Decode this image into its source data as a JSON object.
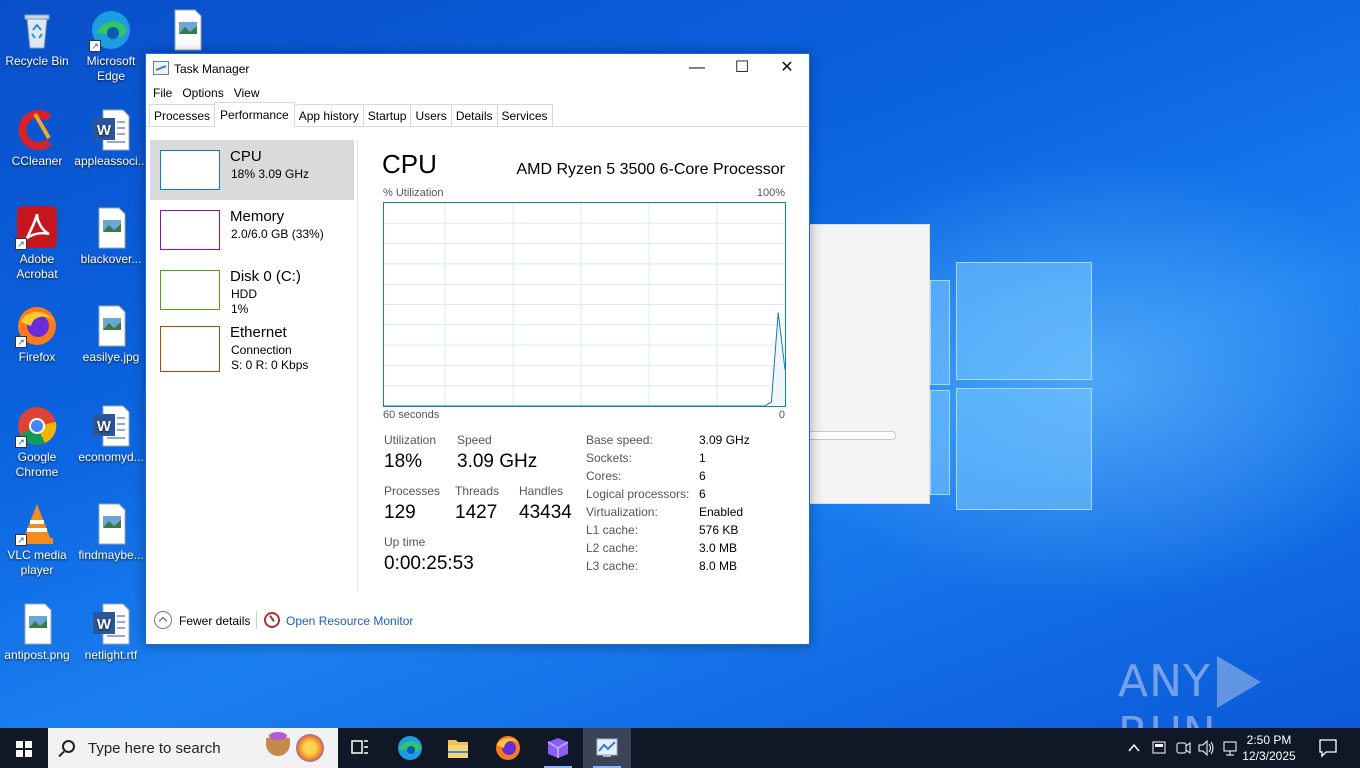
{
  "desktop": {
    "icons": [
      {
        "label": "Recycle Bin"
      },
      {
        "label": "Microsoft Edge"
      },
      {
        "label": "CCleaner"
      },
      {
        "label": "appleassoci..."
      },
      {
        "label": "Adobe Acrobat"
      },
      {
        "label": "blackover..."
      },
      {
        "label": "Firefox"
      },
      {
        "label": "easilye.jpg"
      },
      {
        "label": "Google Chrome"
      },
      {
        "label": "economyd..."
      },
      {
        "label": "VLC media player"
      },
      {
        "label": "findmaybe..."
      },
      {
        "label": "antipost.png"
      },
      {
        "label": "netlight.rtf"
      }
    ],
    "watermark": {
      "left": "ANY",
      "right": "RUN"
    }
  },
  "window": {
    "title": "Task Manager",
    "controls": {
      "minimize": "—",
      "maximize": "☐",
      "close": "✕"
    }
  },
  "menu": [
    "File",
    "Options",
    "View"
  ],
  "tabs": [
    "Processes",
    "Performance",
    "App history",
    "Startup",
    "Users",
    "Details",
    "Services"
  ],
  "active_tab": "Performance",
  "sidebar": [
    {
      "title": "CPU",
      "line1": "18%  3.09 GHz",
      "line2": "",
      "color": "#117dbb"
    },
    {
      "title": "Memory",
      "line1": "2.0/6.0 GB (33%)",
      "line2": "",
      "color": "#8b12ae"
    },
    {
      "title": "Disk 0 (C:)",
      "line1": "HDD",
      "line2": "1%",
      "color": "#4da60c"
    },
    {
      "title": "Ethernet",
      "line1": "Connection",
      "line2": "S: 0  R: 0 Kbps",
      "color": "#a74f01"
    }
  ],
  "cpu": {
    "title": "CPU",
    "model": "AMD Ryzen 5 3500 6-Core Processor",
    "graph_label": "% Utilization",
    "graph_max": "100%",
    "axis_left": "60 seconds",
    "axis_right": "0",
    "graph_series": [
      0,
      0,
      0,
      0,
      0,
      0,
      0,
      0,
      0,
      0,
      0,
      0,
      0,
      0,
      0,
      0,
      0,
      0,
      0,
      0,
      0,
      0,
      0,
      0,
      0,
      0,
      0,
      0,
      0,
      0,
      0,
      0,
      0,
      0,
      0,
      0,
      0,
      0,
      0,
      0,
      0,
      0,
      0,
      0,
      0,
      0,
      0,
      0,
      0,
      0,
      0,
      0,
      0,
      0,
      0,
      0,
      0,
      2,
      46,
      18
    ],
    "stats": {
      "utilization": {
        "label": "Utilization",
        "value": "18%"
      },
      "speed": {
        "label": "Speed",
        "value": "3.09 GHz"
      },
      "processes": {
        "label": "Processes",
        "value": "129"
      },
      "threads": {
        "label": "Threads",
        "value": "1427"
      },
      "handles": {
        "label": "Handles",
        "value": "43434"
      },
      "uptime": {
        "label": "Up time",
        "value": "0:00:25:53"
      }
    },
    "specs": [
      {
        "label": "Base speed:",
        "value": "3.09 GHz"
      },
      {
        "label": "Sockets:",
        "value": "1"
      },
      {
        "label": "Cores:",
        "value": "6"
      },
      {
        "label": "Logical processors:",
        "value": "6"
      },
      {
        "label": "Virtualization:",
        "value": "Enabled"
      },
      {
        "label": "L1 cache:",
        "value": "576 KB"
      },
      {
        "label": "L2 cache:",
        "value": "3.0 MB"
      },
      {
        "label": "L3 cache:",
        "value": "8.0 MB"
      }
    ]
  },
  "footer": {
    "fewer_details": "Fewer details",
    "open_resource_monitor": "Open Resource Monitor"
  },
  "taskbar": {
    "search_placeholder": "Type here to search",
    "time": "2:50 PM",
    "date": "12/3/2025",
    "apps": [
      "task-view-icon",
      "edge-icon",
      "file-explorer-icon",
      "firefox-icon",
      "visual-studio-icon",
      "task-manager-icon"
    ]
  },
  "colors": {
    "accent": "#117dbb",
    "taskbar": "#101828",
    "link": "#1e5fb4"
  }
}
